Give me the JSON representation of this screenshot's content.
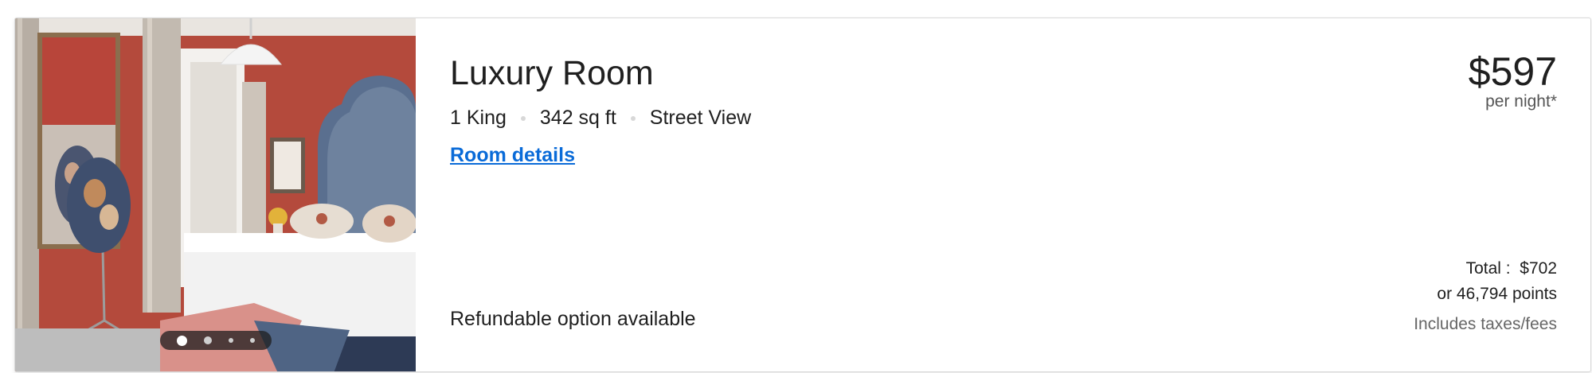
{
  "room": {
    "name": "Luxury Room",
    "features": [
      "1 King",
      "342 sq ft",
      "Street View"
    ],
    "details_link": "Room details",
    "refundable": "Refundable option available"
  },
  "price": {
    "amount": "$597",
    "unit": "per night*",
    "total_label": "Total :",
    "total_value": "$702",
    "points": "or 46,794 points",
    "taxes_note": "Includes taxes/fees"
  },
  "carousel": {
    "image_count": 4,
    "active_index": 0
  },
  "colors": {
    "link": "#0a6bd8",
    "wall": "#b44a3c"
  }
}
